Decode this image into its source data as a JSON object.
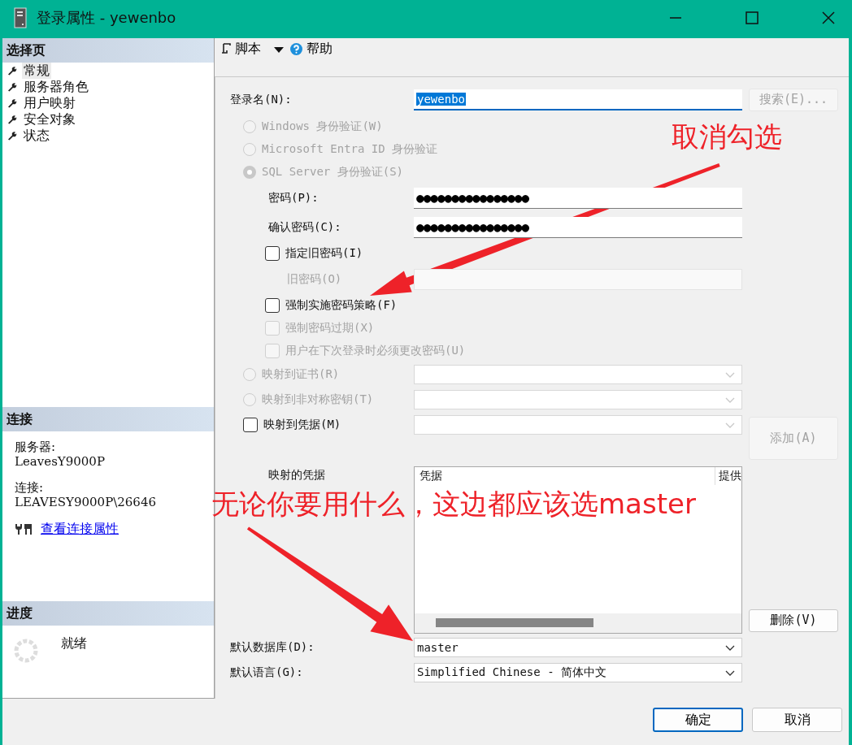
{
  "window": {
    "title": "登录属性 - yewenbo"
  },
  "sidebar": {
    "pages_title": "选择页",
    "pages": [
      {
        "label": "常规",
        "selected": true
      },
      {
        "label": "服务器角色",
        "selected": false
      },
      {
        "label": "用户映射",
        "selected": false
      },
      {
        "label": "安全对象",
        "selected": false
      },
      {
        "label": "状态",
        "selected": false
      }
    ],
    "connection_title": "连接",
    "connection": [
      {
        "label": "服务器:",
        "value": "LeavesY9000P"
      },
      {
        "label": "连接:",
        "value": "LEAVESY9000P\\26646"
      }
    ],
    "connection_link": "查看连接属性",
    "progress_title": "进度",
    "progress_status": "就绪"
  },
  "toolbar": {
    "script": "脚本",
    "help": "帮助"
  },
  "form": {
    "login_name": {
      "label": "登录名(N):",
      "value": "yewenbo"
    },
    "search_button": {
      "label": "搜索(E)...",
      "disabled": true
    },
    "auth_options": [
      {
        "label": "Windows 身份验证(W)",
        "selected": false,
        "disabled": true
      },
      {
        "label": "Microsoft Entra ID 身份验证",
        "selected": false,
        "disabled": true
      },
      {
        "label": "SQL Server 身份验证(S)",
        "selected": true,
        "disabled": true
      }
    ],
    "password": {
      "label": "密码(P):",
      "value": "●●●●●●●●●●●●●●●●"
    },
    "confirm_password": {
      "label": "确认密码(C):",
      "value": "●●●●●●●●●●●●●●●●"
    },
    "specify_old_password": {
      "label": "指定旧密码(I)",
      "checked": false,
      "disabled": false
    },
    "old_password": {
      "label": "旧密码(O)",
      "disabled": true
    },
    "policy_options": [
      {
        "label": "强制实施密码策略(F)",
        "checked": false,
        "disabled": false
      },
      {
        "label": "强制密码过期(X)",
        "checked": false,
        "disabled": true
      },
      {
        "label": "用户在下次登录时必须更改密码(U)",
        "checked": false,
        "disabled": true
      }
    ],
    "mappings": [
      {
        "kind": "radio",
        "label": "映射到证书(R)",
        "checked": false,
        "disabled": true
      },
      {
        "kind": "radio",
        "label": "映射到非对称密钥(T)",
        "checked": false,
        "disabled": true
      },
      {
        "kind": "checkbox",
        "label": "映射到凭据(M)",
        "checked": false,
        "disabled": false
      }
    ],
    "add_button": {
      "label": "添加(A)",
      "disabled": true
    },
    "mapped_credentials": {
      "label": "映射的凭据",
      "columns": [
        "凭据",
        "提供"
      ]
    },
    "delete_button": {
      "label": "删除(V)",
      "disabled": false
    },
    "default_database": {
      "label": "默认数据库(D):",
      "value": "master"
    },
    "default_language": {
      "label": "默认语言(G):",
      "value": "Simplified Chinese - 简体中文"
    }
  },
  "buttons": [
    {
      "label": "确定",
      "default": true
    },
    {
      "label": "取消",
      "default": false
    }
  ],
  "annotations": [
    {
      "kind": "note-top",
      "text": "取消勾选"
    },
    {
      "kind": "note-bottom",
      "text": "无论你要用什么，这边都应该选master"
    }
  ]
}
